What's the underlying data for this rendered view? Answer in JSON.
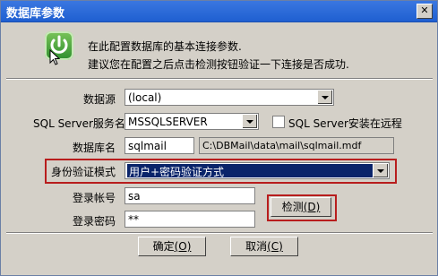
{
  "window": {
    "title": "数据库参数"
  },
  "header": {
    "line1": "在此配置数据库的基本连接参数.",
    "line2": "建议您在配置之后点击检测按钮验证一下连接是否成功."
  },
  "form": {
    "datasource_label": "数据源",
    "datasource_value": "(local)",
    "service_label": "SQL Server服务名",
    "service_value": "MSSQLSERVER",
    "remote_label": "SQL Server安装在远程",
    "remote_checked": false,
    "dbname_label": "数据库名",
    "dbname_value": "sqlmail",
    "dbpath_value": "C:\\DBMail\\data\\mail\\sqlmail.mdf",
    "auth_label": "身份验证模式",
    "auth_value": "用户+密码验证方式",
    "login_label": "登录帐号",
    "login_value": "sa",
    "password_label": "登录密码",
    "password_value": "**"
  },
  "buttons": {
    "test_label": "检测",
    "test_key": "(D)",
    "ok_label": "确定",
    "ok_key": "(O)",
    "cancel_label": "取消",
    "cancel_key": "(C)"
  },
  "colors": {
    "title_bar": "#2a6ad8",
    "highlight_border": "#b81d1d",
    "selected_bg": "#0a246a"
  }
}
